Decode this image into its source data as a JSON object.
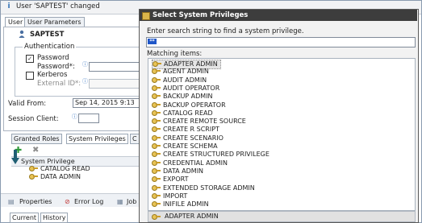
{
  "notice": {
    "text": "User 'SAPTEST' changed",
    "icon": "info-icon"
  },
  "editor_tabs": [
    "User",
    "User Parameters"
  ],
  "user": {
    "name": "SAPTEST"
  },
  "auth": {
    "group_label": "Authentication",
    "password_label": "Password",
    "password_field_label": "Password*:",
    "kerberos_label": "Kerberos",
    "external_id_label": "External ID*:"
  },
  "valid_from": {
    "label": "Valid From:",
    "value": "Sep 14, 2015 9:13"
  },
  "session_client": {
    "label": "Session Client:"
  },
  "granted_tabs": [
    "Granted Roles",
    "System Privileges",
    "C"
  ],
  "granted": {
    "column": "System Privilege",
    "items": [
      "CATALOG READ",
      "DATA ADMIN"
    ]
  },
  "bottom_tabs": [
    "Properties",
    "Error Log",
    "Job"
  ],
  "console_tabs": [
    "Current",
    "History"
  ],
  "dialog": {
    "title": "Select System Privileges",
    "prompt": "Enter search string to find a system privilege.",
    "search_value": "**",
    "matching_label": "Matching items:",
    "items": [
      "ADAPTER ADMIN",
      "AGENT ADMIN",
      "AUDIT ADMIN",
      "AUDIT OPERATOR",
      "BACKUP ADMIN",
      "BACKUP OPERATOR",
      "CATALOG READ",
      "CREATE REMOTE SOURCE",
      "CREATE R SCRIPT",
      "CREATE SCENARIO",
      "CREATE SCHEMA",
      "CREATE STRUCTURED PRIVILEGE",
      "CREDENTIAL ADMIN",
      "DATA ADMIN",
      "EXPORT",
      "EXTENDED STORAGE ADMIN",
      "IMPORT",
      "INIFILE ADMIN"
    ],
    "selected_index": 0,
    "status_text": "ADAPTER ADMIN"
  },
  "colors": {
    "title_bar": "#3d3d3d",
    "accent_green": "#2f9a3a",
    "search_button": "#1f56c8"
  }
}
